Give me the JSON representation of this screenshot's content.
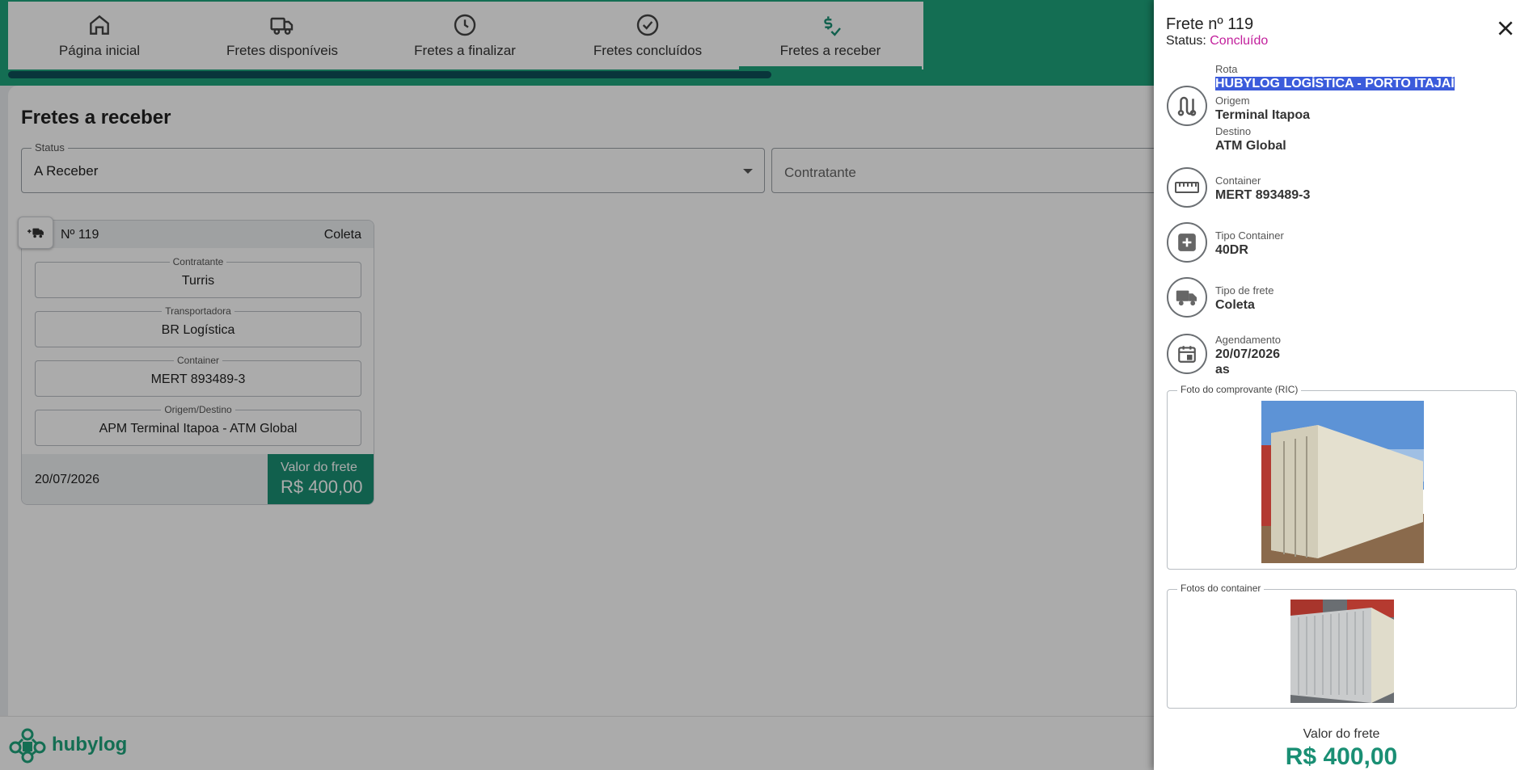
{
  "tabs": [
    {
      "label": "Página inicial",
      "icon": "home-icon"
    },
    {
      "label": "Fretes disponíveis",
      "icon": "truck-icon"
    },
    {
      "label": "Fretes a finalizar",
      "icon": "clock-icon"
    },
    {
      "label": "Fretes concluídos",
      "icon": "check-circle-icon"
    },
    {
      "label": "Fretes a receber",
      "icon": "dollar-check-icon"
    }
  ],
  "page": {
    "title": "Fretes a receber",
    "status_label": "Status",
    "status_value": "A Receber",
    "contratante_placeholder": "Contratante"
  },
  "card": {
    "number": "Nº 119",
    "type": "Coleta",
    "fields": [
      {
        "label": "Contratante",
        "value": "Turris"
      },
      {
        "label": "Transportadora",
        "value": "BR Logística"
      },
      {
        "label": "Container",
        "value": "MERT 893489-3"
      },
      {
        "label": "Origem/Destino",
        "value": "APM Terminal Itapoa - ATM Global"
      }
    ],
    "date": "20/07/2026",
    "price_label": "Valor do frete",
    "price_value": "R$ 400,00"
  },
  "brand": {
    "name": "hubylog"
  },
  "drawer": {
    "title": "Frete nº 119",
    "status_prefix": "Status: ",
    "status_value": "Concluído",
    "rota_label": "Rota",
    "rota_value": "HUBYLOG LOGÍSTICA - PORTO ITAJAÍ",
    "origem_label": "Origem",
    "origem_value": "Terminal Itapoa",
    "destino_label": "Destino",
    "destino_value": "ATM Global",
    "container_label": "Container",
    "container_value": "MERT 893489-3",
    "tipo_container_label": "Tipo Container",
    "tipo_container_value": "40DR",
    "tipo_frete_label": "Tipo de frete",
    "tipo_frete_value": "Coleta",
    "agendamento_label": "Agendamento",
    "agendamento_date": "20/07/2026",
    "agendamento_time": "as",
    "foto_ric_label": "Foto do comprovante (RIC)",
    "fotos_container_label": "Fotos do container",
    "price_label": "Valor do frete",
    "price_value": "R$ 400,00"
  },
  "colors": {
    "brand_green": "#1fa47c",
    "dark_teal": "#0e4f59",
    "status_magenta": "#c21f9c",
    "price_green": "#1a8f74"
  }
}
